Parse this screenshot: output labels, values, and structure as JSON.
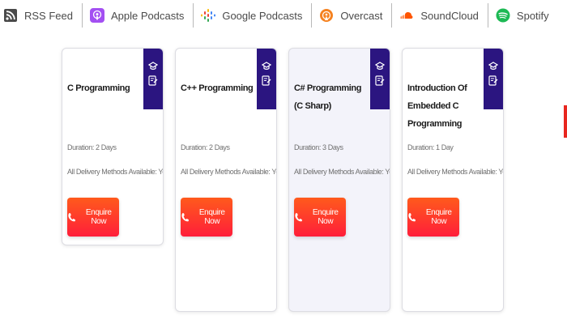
{
  "podcast_bar": [
    {
      "label": "RSS Feed",
      "icon": "rss-icon"
    },
    {
      "label": "Apple Podcasts",
      "icon": "apple-podcasts-icon"
    },
    {
      "label": "Google Podcasts",
      "icon": "google-podcasts-icon"
    },
    {
      "label": "Overcast",
      "icon": "overcast-icon"
    },
    {
      "label": "SoundCloud",
      "icon": "soundcloud-icon"
    },
    {
      "label": "Spotify",
      "icon": "spotify-icon"
    }
  ],
  "courses": [
    {
      "title": "C Programming",
      "duration": "Duration: 2 Days",
      "delivery": "All Delivery Methods Available: Yes",
      "button": "Enquire Now"
    },
    {
      "title": "C++ Programming",
      "duration": "Duration: 2 Days",
      "delivery": "All Delivery Methods Available: Yes",
      "button": "Enquire Now"
    },
    {
      "title": "C# Programming (C Sharp)",
      "duration": "Duration: 3 Days",
      "delivery": "All Delivery Methods Available: Yes",
      "button": "Enquire Now"
    },
    {
      "title": "Introduction Of Embedded C Programming",
      "duration": "Duration: 1 Day",
      "delivery": "All Delivery Methods Available: Yes",
      "button": "Enquire Now"
    }
  ],
  "colors": {
    "corner_badge": "#2b1580",
    "enquire_gradient_top": "#ff5a1c",
    "enquire_gradient_bottom": "#ff1e3a",
    "apple_podcasts": "#a34ff2",
    "overcast": "#f58220",
    "soundcloud": "#ff5500",
    "spotify": "#1db954"
  }
}
